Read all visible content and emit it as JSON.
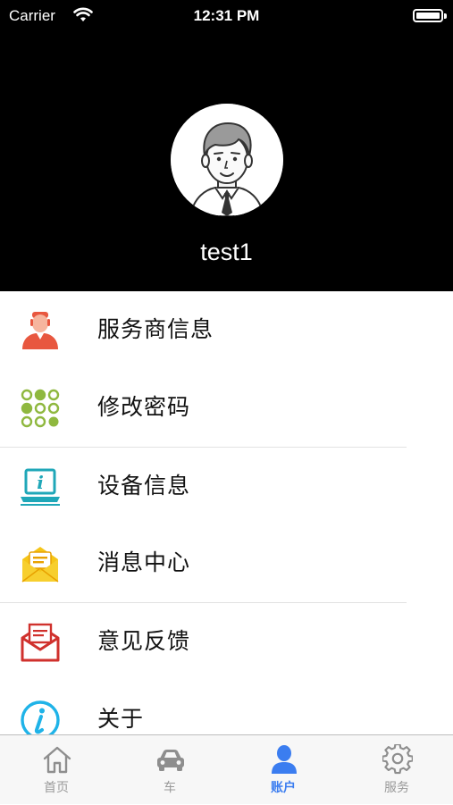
{
  "status_bar": {
    "carrier": "Carrier",
    "time": "12:31 PM"
  },
  "profile": {
    "username": "test1"
  },
  "menu": {
    "items": [
      {
        "label": "服务商信息",
        "icon": "service-provider-icon"
      },
      {
        "label": "修改密码",
        "icon": "keypad-icon"
      },
      {
        "label": "设备信息",
        "icon": "laptop-info-icon"
      },
      {
        "label": "消息中心",
        "icon": "message-envelope-icon"
      },
      {
        "label": "意见反馈",
        "icon": "feedback-envelope-icon"
      },
      {
        "label": "关于",
        "icon": "info-icon"
      }
    ]
  },
  "tab_bar": {
    "tabs": [
      {
        "label": "首页",
        "icon": "home-icon",
        "active": false
      },
      {
        "label": "车",
        "icon": "car-icon",
        "active": false
      },
      {
        "label": "账户",
        "icon": "account-icon",
        "active": true
      },
      {
        "label": "服务",
        "icon": "gear-icon",
        "active": false
      }
    ]
  },
  "colors": {
    "header_bg": "#000000",
    "active_tab": "#3b7df0",
    "inactive_tab": "#9a9a9a"
  }
}
